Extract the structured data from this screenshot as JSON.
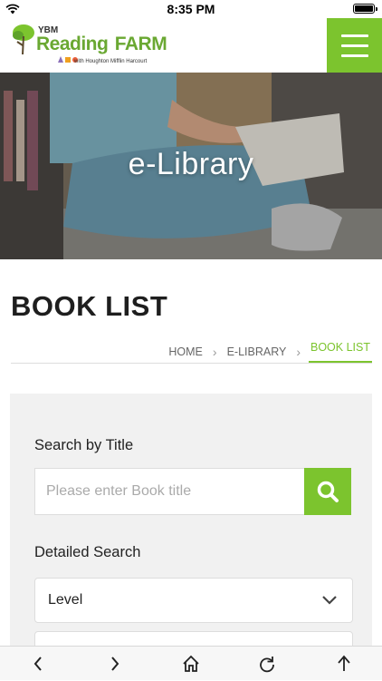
{
  "status_bar": {
    "time": "8:35 PM"
  },
  "header": {
    "logo": {
      "small": "YBM",
      "main": "Reading",
      "farm": "FARM",
      "sub": "with Houghton Mifflin Harcourt"
    }
  },
  "hero": {
    "title": "e-Library"
  },
  "page": {
    "title": "BOOK LIST"
  },
  "breadcrumb": {
    "items": [
      "HOME",
      "E-LIBRARY",
      "BOOK LIST"
    ]
  },
  "search": {
    "title_label": "Search by Title",
    "title_placeholder": "Please enter Book title",
    "detailed_label": "Detailed Search",
    "level_value": "Level"
  },
  "colors": {
    "accent": "#7cc42e"
  },
  "icons": {
    "menu": "hamburger-icon",
    "search": "search-icon",
    "select": "chevron-down-icon",
    "back": "back-arrow-icon",
    "forward": "forward-arrow-icon",
    "home": "home-icon",
    "reload": "reload-icon",
    "share": "share-icon"
  }
}
